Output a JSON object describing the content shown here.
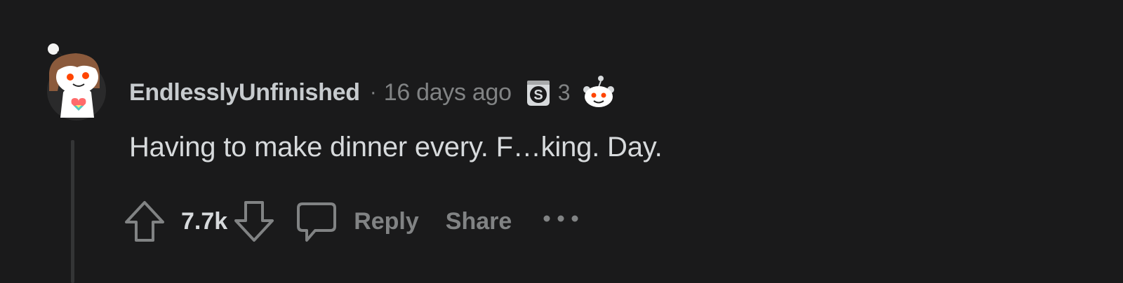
{
  "comment": {
    "author": "EndlesslyUnfinished",
    "separator": "·",
    "timestamp": "16 days ago",
    "award": {
      "icon": "silver-award-icon",
      "count": "3"
    },
    "body": "Having to make dinner every. F…king. Day.",
    "score": "7.7k",
    "actions": {
      "reply_label": "Reply",
      "share_label": "Share"
    }
  },
  "icons": {
    "upvote": "arrow-up-icon",
    "downvote": "arrow-down-icon",
    "comment": "speech-bubble-icon",
    "more": "ellipsis-icon",
    "avatar": "snoo-avatar-icon"
  },
  "colors": {
    "background": "#1a1a1b",
    "text_primary": "#d7dadc",
    "text_muted": "#818384",
    "thread_line": "#343536",
    "avatar_bg": "#2a2a2b",
    "hair": "#8b5a3c",
    "eyes": "#ff4500"
  }
}
